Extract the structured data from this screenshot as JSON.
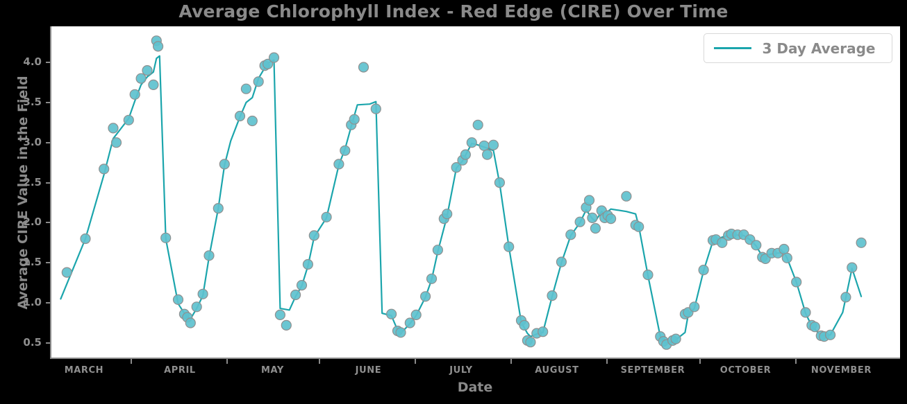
{
  "chart_data": {
    "type": "scatter",
    "title": "Average Chlorophyll Index - Red Edge (CIRE) Over Time",
    "xlabel": "Date",
    "ylabel": "Average CIRE Value in the Field",
    "ylim": [
      0.3,
      4.45
    ],
    "yticks": [
      0.5,
      1.0,
      1.5,
      2.0,
      2.5,
      3.0,
      3.5,
      4.0
    ],
    "ytick_labels": [
      "0.5",
      "1.0",
      "1.5",
      "2.0",
      "2.5",
      "3.0",
      "3.5",
      "4.0"
    ],
    "xlim": [
      0,
      275
    ],
    "xtick_labels": [
      "MARCH",
      "APRIL",
      "MAY",
      "JUNE",
      "JULY",
      "AUGUST",
      "SEPTEMBER",
      "OCTOBER",
      "NOVEMBER"
    ],
    "xtick_positions": [
      11,
      42,
      72,
      103,
      133,
      164,
      195,
      225,
      256
    ],
    "xtick_mark_positions": [
      26,
      57,
      87,
      118,
      149,
      180,
      210,
      241
    ],
    "grid": false,
    "legend_position": "top-right",
    "marker_color": "#5ec1ce",
    "marker_edge_color": "#8f8f8f",
    "line_color": "#1ba5ac",
    "plot_bg": "#ffffff",
    "figure_bg": "#000000",
    "text_color": "#8a8a8a",
    "series": [
      {
        "name": "Scatter Points",
        "kind": "scatter",
        "points": [
          [
            5,
            1.38
          ],
          [
            11,
            1.8
          ],
          [
            17,
            2.67
          ],
          [
            20,
            3.18
          ],
          [
            21,
            3.0
          ],
          [
            25,
            3.28
          ],
          [
            27,
            3.6
          ],
          [
            29,
            3.8
          ],
          [
            31,
            3.9
          ],
          [
            33,
            3.72
          ],
          [
            34,
            4.27
          ],
          [
            34.5,
            4.2
          ],
          [
            37,
            1.81
          ],
          [
            41,
            1.04
          ],
          [
            43,
            0.86
          ],
          [
            44,
            0.82
          ],
          [
            45,
            0.75
          ],
          [
            47,
            0.95
          ],
          [
            49,
            1.11
          ],
          [
            51,
            1.59
          ],
          [
            54,
            2.18
          ],
          [
            56,
            2.73
          ],
          [
            61,
            3.33
          ],
          [
            63,
            3.67
          ],
          [
            65,
            3.27
          ],
          [
            67,
            3.76
          ],
          [
            69,
            3.96
          ],
          [
            70,
            3.98
          ],
          [
            72,
            4.06
          ],
          [
            74,
            0.85
          ],
          [
            76,
            0.72
          ],
          [
            79,
            1.1
          ],
          [
            81,
            1.22
          ],
          [
            83,
            1.48
          ],
          [
            85,
            1.84
          ],
          [
            89,
            2.07
          ],
          [
            93,
            2.73
          ],
          [
            95,
            2.9
          ],
          [
            97,
            3.22
          ],
          [
            98,
            3.29
          ],
          [
            101,
            3.94
          ],
          [
            105,
            3.42
          ],
          [
            110,
            0.86
          ],
          [
            112,
            0.65
          ],
          [
            113,
            0.63
          ],
          [
            116,
            0.75
          ],
          [
            118,
            0.85
          ],
          [
            121,
            1.08
          ],
          [
            123,
            1.3
          ],
          [
            125,
            1.66
          ],
          [
            127,
            2.05
          ],
          [
            128,
            2.11
          ],
          [
            131,
            2.69
          ],
          [
            133,
            2.78
          ],
          [
            134,
            2.85
          ],
          [
            136,
            3.0
          ],
          [
            138,
            3.22
          ],
          [
            140,
            2.96
          ],
          [
            141,
            2.85
          ],
          [
            143,
            2.97
          ],
          [
            145,
            2.5
          ],
          [
            148,
            1.7
          ],
          [
            152,
            0.78
          ],
          [
            153,
            0.72
          ],
          [
            154,
            0.53
          ],
          [
            155,
            0.51
          ],
          [
            157,
            0.62
          ],
          [
            159,
            0.64
          ],
          [
            162,
            1.09
          ],
          [
            165,
            1.51
          ],
          [
            168,
            1.85
          ],
          [
            171,
            2.01
          ],
          [
            173,
            2.19
          ],
          [
            174,
            2.28
          ],
          [
            175,
            2.06
          ],
          [
            176,
            1.93
          ],
          [
            178,
            2.15
          ],
          [
            179,
            2.06
          ],
          [
            180,
            2.09
          ],
          [
            181,
            2.05
          ],
          [
            186,
            2.33
          ],
          [
            189,
            1.97
          ],
          [
            190,
            1.95
          ],
          [
            193,
            1.35
          ],
          [
            197,
            0.58
          ],
          [
            198,
            0.52
          ],
          [
            199,
            0.48
          ],
          [
            201,
            0.53
          ],
          [
            202,
            0.55
          ],
          [
            205,
            0.86
          ],
          [
            206,
            0.88
          ],
          [
            208,
            0.95
          ],
          [
            211,
            1.41
          ],
          [
            214,
            1.78
          ],
          [
            215,
            1.79
          ],
          [
            217,
            1.75
          ],
          [
            219,
            1.84
          ],
          [
            220,
            1.86
          ],
          [
            222,
            1.85
          ],
          [
            224,
            1.85
          ],
          [
            226,
            1.79
          ],
          [
            228,
            1.72
          ],
          [
            230,
            1.57
          ],
          [
            231,
            1.55
          ],
          [
            233,
            1.62
          ],
          [
            235,
            1.62
          ],
          [
            237,
            1.67
          ],
          [
            238,
            1.56
          ],
          [
            241,
            1.26
          ],
          [
            244,
            0.88
          ],
          [
            246,
            0.72
          ],
          [
            247,
            0.7
          ],
          [
            249,
            0.59
          ],
          [
            250,
            0.58
          ],
          [
            252,
            0.6
          ],
          [
            257,
            1.07
          ],
          [
            259,
            1.44
          ],
          [
            262,
            1.75
          ]
        ]
      },
      {
        "name": "3 Day Average",
        "kind": "line",
        "points": [
          [
            3,
            1.05
          ],
          [
            11,
            1.8
          ],
          [
            17,
            2.6
          ],
          [
            20,
            3.05
          ],
          [
            25,
            3.3
          ],
          [
            27,
            3.52
          ],
          [
            29,
            3.72
          ],
          [
            31,
            3.82
          ],
          [
            33,
            3.88
          ],
          [
            34,
            4.05
          ],
          [
            35,
            4.08
          ],
          [
            37,
            1.8
          ],
          [
            41,
            0.99
          ],
          [
            43,
            0.87
          ],
          [
            44,
            0.83
          ],
          [
            45,
            0.8
          ],
          [
            47,
            0.93
          ],
          [
            49,
            1.09
          ],
          [
            51,
            1.57
          ],
          [
            54,
            2.18
          ],
          [
            56,
            2.72
          ],
          [
            58,
            3.02
          ],
          [
            61,
            3.32
          ],
          [
            63,
            3.5
          ],
          [
            65,
            3.56
          ],
          [
            67,
            3.8
          ],
          [
            69,
            3.93
          ],
          [
            70,
            3.99
          ],
          [
            72,
            4.03
          ],
          [
            74,
            0.93
          ],
          [
            77,
            0.91
          ],
          [
            79,
            1.08
          ],
          [
            81,
            1.21
          ],
          [
            83,
            1.46
          ],
          [
            85,
            1.82
          ],
          [
            89,
            2.06
          ],
          [
            93,
            2.72
          ],
          [
            95,
            2.92
          ],
          [
            97,
            3.2
          ],
          [
            99,
            3.47
          ],
          [
            103,
            3.48
          ],
          [
            105,
            3.51
          ],
          [
            107,
            0.87
          ],
          [
            110,
            0.84
          ],
          [
            112,
            0.66
          ],
          [
            113,
            0.62
          ],
          [
            116,
            0.74
          ],
          [
            118,
            0.84
          ],
          [
            121,
            1.07
          ],
          [
            123,
            1.29
          ],
          [
            125,
            1.64
          ],
          [
            128,
            2.08
          ],
          [
            131,
            2.68
          ],
          [
            133,
            2.77
          ],
          [
            136,
            2.99
          ],
          [
            138,
            2.97
          ],
          [
            141,
            2.93
          ],
          [
            143,
            2.9
          ],
          [
            145,
            2.49
          ],
          [
            148,
            1.7
          ],
          [
            152,
            0.76
          ],
          [
            154,
            0.62
          ],
          [
            155,
            0.58
          ],
          [
            157,
            0.61
          ],
          [
            159,
            0.63
          ],
          [
            162,
            1.08
          ],
          [
            165,
            1.5
          ],
          [
            168,
            1.84
          ],
          [
            171,
            2.0
          ],
          [
            173,
            2.16
          ],
          [
            175,
            2.05
          ],
          [
            176,
            2.02
          ],
          [
            178,
            2.14
          ],
          [
            179,
            2.11
          ],
          [
            181,
            2.17
          ],
          [
            186,
            2.14
          ],
          [
            189,
            2.11
          ],
          [
            190,
            1.96
          ],
          [
            193,
            1.34
          ],
          [
            197,
            0.58
          ],
          [
            199,
            0.5
          ],
          [
            201,
            0.51
          ],
          [
            202,
            0.54
          ],
          [
            205,
            0.63
          ],
          [
            206,
            0.85
          ],
          [
            208,
            0.93
          ],
          [
            211,
            1.4
          ],
          [
            214,
            1.77
          ],
          [
            217,
            1.82
          ],
          [
            220,
            1.85
          ],
          [
            224,
            1.84
          ],
          [
            226,
            1.79
          ],
          [
            228,
            1.71
          ],
          [
            230,
            1.58
          ],
          [
            233,
            1.61
          ],
          [
            235,
            1.62
          ],
          [
            237,
            1.63
          ],
          [
            238,
            1.56
          ],
          [
            241,
            1.26
          ],
          [
            244,
            0.87
          ],
          [
            246,
            0.71
          ],
          [
            249,
            0.59
          ],
          [
            252,
            0.6
          ],
          [
            256,
            0.88
          ],
          [
            259,
            1.43
          ],
          [
            262,
            1.08
          ]
        ]
      }
    ]
  },
  "legend": {
    "label": "3 Day Average"
  }
}
